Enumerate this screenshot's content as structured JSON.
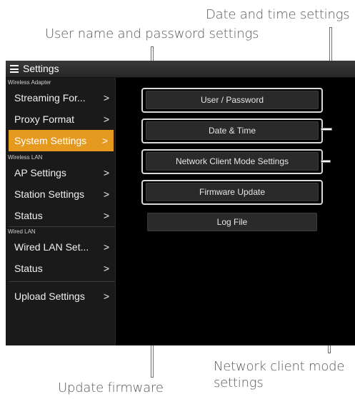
{
  "callouts": {
    "date_time": "Date and time settings",
    "user_password": "User name and password settings",
    "network_client_line1": "Network client mode",
    "network_client_line2": "settings",
    "update_firmware": "Update firmware"
  },
  "titlebar": {
    "title": "Settings",
    "icon": "hamburger-menu-icon"
  },
  "sidebar": {
    "groups": [
      {
        "label": "Wireless Adapter",
        "items": [
          {
            "label": "Streaming For...",
            "chevron": ">"
          },
          {
            "label": "Proxy Format",
            "chevron": ">"
          },
          {
            "label": "System Settings",
            "chevron": ">",
            "active": true
          }
        ]
      },
      {
        "label": "Wireless LAN",
        "items": [
          {
            "label": "AP Settings",
            "chevron": ">"
          },
          {
            "label": "Station Settings",
            "chevron": ">"
          },
          {
            "label": "Status",
            "chevron": ">"
          }
        ]
      },
      {
        "label": "Wired LAN",
        "items": [
          {
            "label": "Wired LAN Set...",
            "chevron": ">"
          },
          {
            "label": "Status",
            "chevron": ">"
          }
        ]
      }
    ],
    "upload": {
      "label": "Upload Settings",
      "chevron": ">"
    }
  },
  "main": {
    "buttons": {
      "user_password": "User / Password",
      "date_time": "Date & Time",
      "network_client": "Network Client Mode Settings",
      "firmware_update": "Firmware Update",
      "log_file": "Log File"
    }
  },
  "colors": {
    "active_item": "#e59a1f",
    "panel_bg": "#000000",
    "callout_text": "#595959"
  }
}
